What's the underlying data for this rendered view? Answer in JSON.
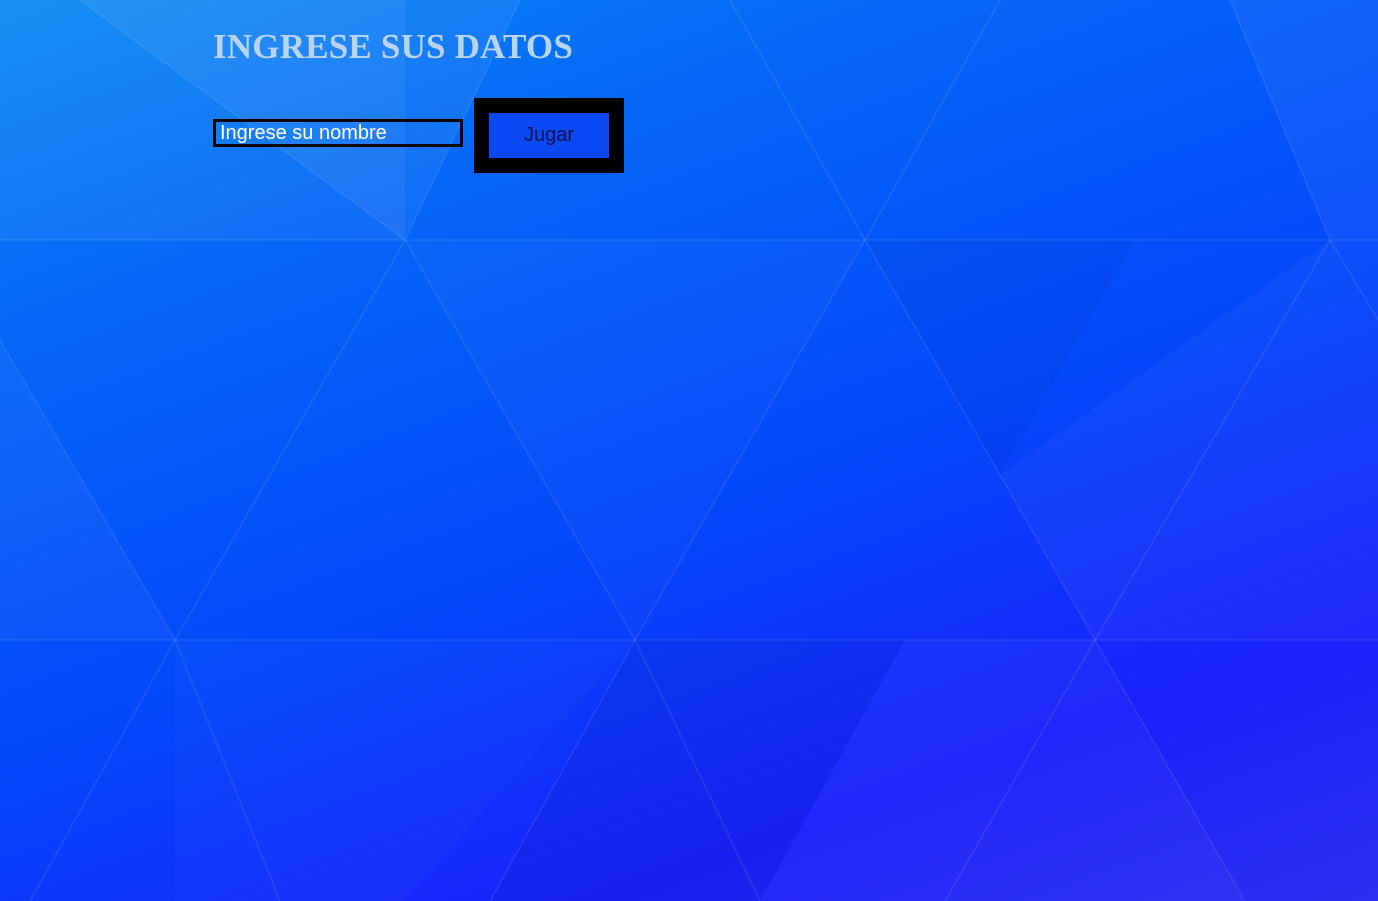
{
  "page": {
    "title": "INGRESE SUS DATOS"
  },
  "form": {
    "name_placeholder": "Ingrese su nombre",
    "name_value": "",
    "play_label": "Jugar"
  },
  "colors": {
    "title_text": "#b8d4f2",
    "input_border": "#000000",
    "button_border": "#000000",
    "button_fill": "#0b49f4",
    "button_text": "#0a1450",
    "background_start": "#0a8af5",
    "background_end": "#2a30f0"
  }
}
